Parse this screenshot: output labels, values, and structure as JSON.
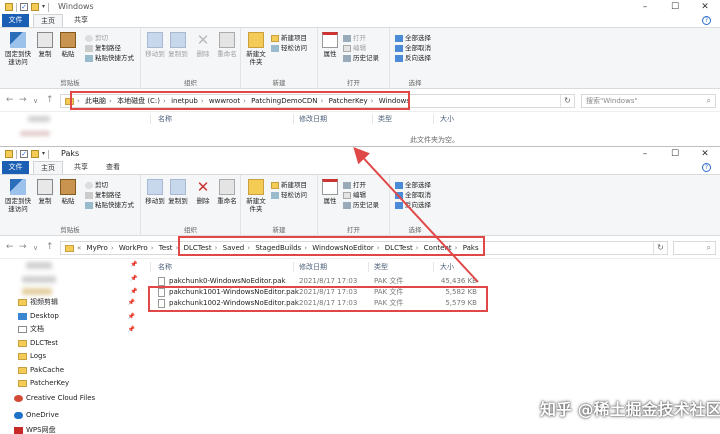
{
  "top_window": {
    "title": "Windows",
    "tabs": {
      "file": "文件",
      "home": "主页",
      "share": "共享"
    },
    "ribbon": {
      "pin": "固定到快速访问",
      "copy": "复制",
      "paste": "粘贴",
      "cut": "剪切",
      "copy_path": "复制路径",
      "paste_shortcut": "粘贴快捷方式",
      "clipboard": "剪贴板",
      "move_to": "移动到",
      "copy_to": "复制到",
      "delete": "删除",
      "rename": "重命名",
      "organize": "组织",
      "new_folder": "新建文件夹",
      "new_item": "新建项目",
      "easy_access": "轻松访问",
      "new": "新建",
      "properties": "属性",
      "open": "打开",
      "edit": "编辑",
      "history": "历史记录",
      "open_group": "打开",
      "select_all": "全部选择",
      "select_none": "全部取消",
      "invert": "反向选择",
      "select": "选择"
    },
    "address": [
      "此电脑",
      "本地磁盘 (C:)",
      "inetpub",
      "wwwroot",
      "PatchingDemoCDN",
      "PatcherKey",
      "Windows"
    ],
    "search_placeholder": "搜索\"Windows\"",
    "columns": {
      "name": "名称",
      "date": "修改日期",
      "type": "类型",
      "size": "大小"
    },
    "empty_msg": "此文件夹为空。"
  },
  "bottom_window": {
    "title": "Paks",
    "tabs": {
      "file": "文件",
      "home": "主页",
      "share": "共享",
      "view": "查看"
    },
    "ribbon": {
      "pin": "固定到快速访问",
      "copy": "复制",
      "paste": "粘贴",
      "cut": "剪切",
      "copy_path": "复制路径",
      "paste_shortcut": "粘贴快捷方式",
      "clipboard": "剪贴板",
      "move_to": "移动到",
      "copy_to": "复制到",
      "delete": "删除",
      "rename": "重命名",
      "organize": "组织",
      "new_folder": "新建文件夹",
      "new_item": "新建项目",
      "easy_access": "轻松访问",
      "new": "新建",
      "properties": "属性",
      "open": "打开",
      "edit": "编辑",
      "history": "历史记录",
      "open_group": "打开",
      "select_all": "全部选择",
      "select_none": "全部取消",
      "invert": "反向选择",
      "select": "选择"
    },
    "address": [
      "MyPro",
      "WorkPro",
      "Test",
      "DLCTest",
      "Saved",
      "StagedBuilds",
      "WindowsNoEditor",
      "DLCTest",
      "Content",
      "Paks"
    ],
    "columns": {
      "name": "名称",
      "date": "修改日期",
      "type": "类型",
      "size": "大小"
    },
    "files": [
      {
        "name": "pakchunk0-WindowsNoEditor.pak",
        "date": "2021/8/17 17:03",
        "type": "PAK 文件",
        "size": "45,436 KB"
      },
      {
        "name": "pakchunk1001-WindowsNoEditor.pak",
        "date": "2021/8/17 17:03",
        "type": "PAK 文件",
        "size": "5,582 KB"
      },
      {
        "name": "pakchunk1002-WindowsNoEditor.pak",
        "date": "2021/8/17 17:03",
        "type": "PAK 文件",
        "size": "5,579 KB"
      }
    ],
    "sidebar": [
      "视频剪辑",
      "Desktop",
      "文档",
      "DLCTest",
      "Logs",
      "PakCache",
      "PatcherKey",
      "Creative Cloud Files",
      "OneDrive",
      "WPS网盘"
    ]
  },
  "watermark": "知乎 @稀土掘金技术社区",
  "colors": {
    "accent": "#1a5fb4",
    "highlight": "#e04848"
  }
}
